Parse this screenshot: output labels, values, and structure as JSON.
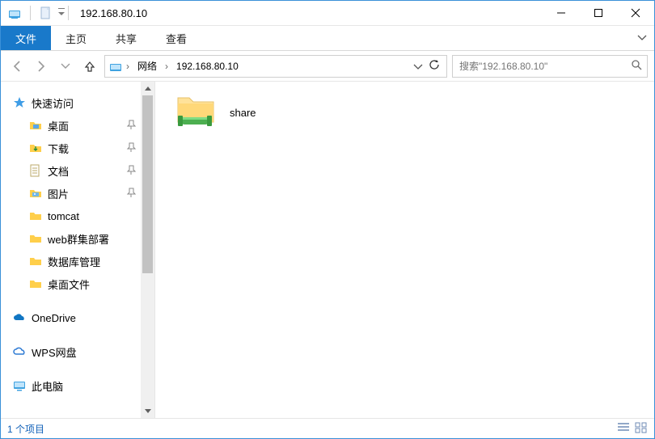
{
  "titlebar": {
    "title": "192.168.80.10"
  },
  "ribbon": {
    "file": "文件",
    "home": "主页",
    "share": "共享",
    "view": "查看"
  },
  "breadcrumb": {
    "root": "网络",
    "host": "192.168.80.10"
  },
  "search": {
    "placeholder": "搜索\"192.168.80.10\""
  },
  "navpane": {
    "quick_access": "快速访问",
    "items": [
      {
        "label": "桌面",
        "pinned": true
      },
      {
        "label": "下载",
        "pinned": true
      },
      {
        "label": "文档",
        "pinned": true
      },
      {
        "label": "图片",
        "pinned": true
      },
      {
        "label": "tomcat",
        "pinned": false
      },
      {
        "label": "web群集部署",
        "pinned": false
      },
      {
        "label": "数据库管理",
        "pinned": false
      },
      {
        "label": "桌面文件",
        "pinned": false
      }
    ],
    "onedrive": "OneDrive",
    "wps": "WPS网盘",
    "thispc": "此电脑"
  },
  "content": {
    "items": [
      {
        "label": "share"
      }
    ]
  },
  "statusbar": {
    "text": "1 个项目"
  }
}
